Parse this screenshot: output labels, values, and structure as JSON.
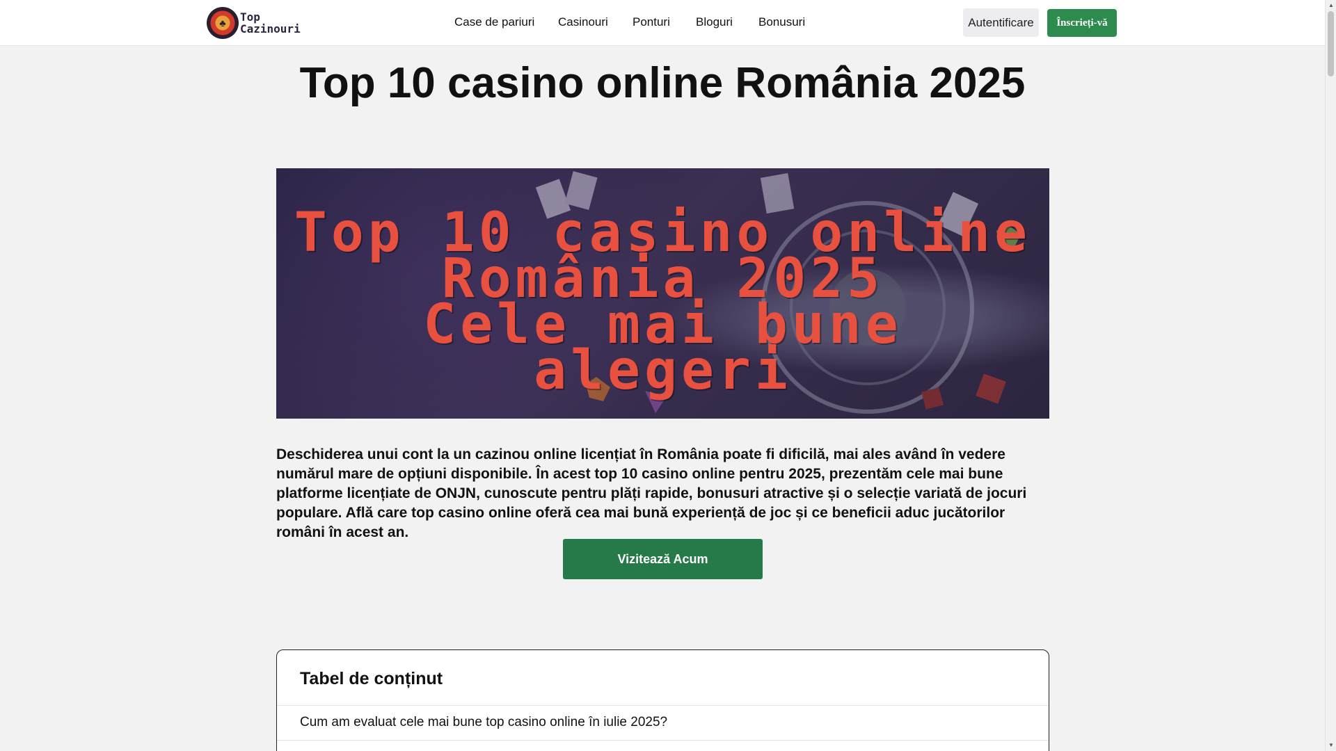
{
  "header": {
    "logo": {
      "line1": "Top",
      "line2": "Cazinouri",
      "icon": "club-chip-icon"
    },
    "nav": [
      {
        "label": "Case de pariuri"
      },
      {
        "label": "Casinouri"
      },
      {
        "label": "Ponturi"
      },
      {
        "label": "Bloguri"
      },
      {
        "label": "Bonusuri"
      }
    ],
    "login_label": "Autentificare",
    "signup_label": "Înscrieți-vă"
  },
  "main": {
    "title": "Top 10 casino online România 2025",
    "hero": {
      "line1": "Top 10 casino online",
      "line2": "România 2025",
      "line3": "Cele mai bune alegeri"
    },
    "intro": "Deschiderea unui cont la un cazinou online licențiat în România poate fi dificilă, mai ales având în vedere numărul mare de opțiuni disponibile. În acest top 10 casino online pentru 2025, prezentăm cele mai bune platforme licențiate de ONJN, cunoscute pentru plăți rapide, bonusuri atractive și o selecție variată de jocuri populare. Află care top casino online oferă cea mai bună experiență de joc și ce beneficii aduc jucătorilor români în acest an.",
    "cta_label": "Vizitează Acum"
  },
  "toc": {
    "title": "Tabel de conținut",
    "items": [
      {
        "label": "Cum am evaluat cele mai bune top casino online în iulie 2025?"
      }
    ]
  },
  "colors": {
    "accent_green": "#2e8b4e",
    "cta_green": "#267a4a",
    "hero_text": "#e8503f",
    "hero_bg": "#2a2242"
  }
}
